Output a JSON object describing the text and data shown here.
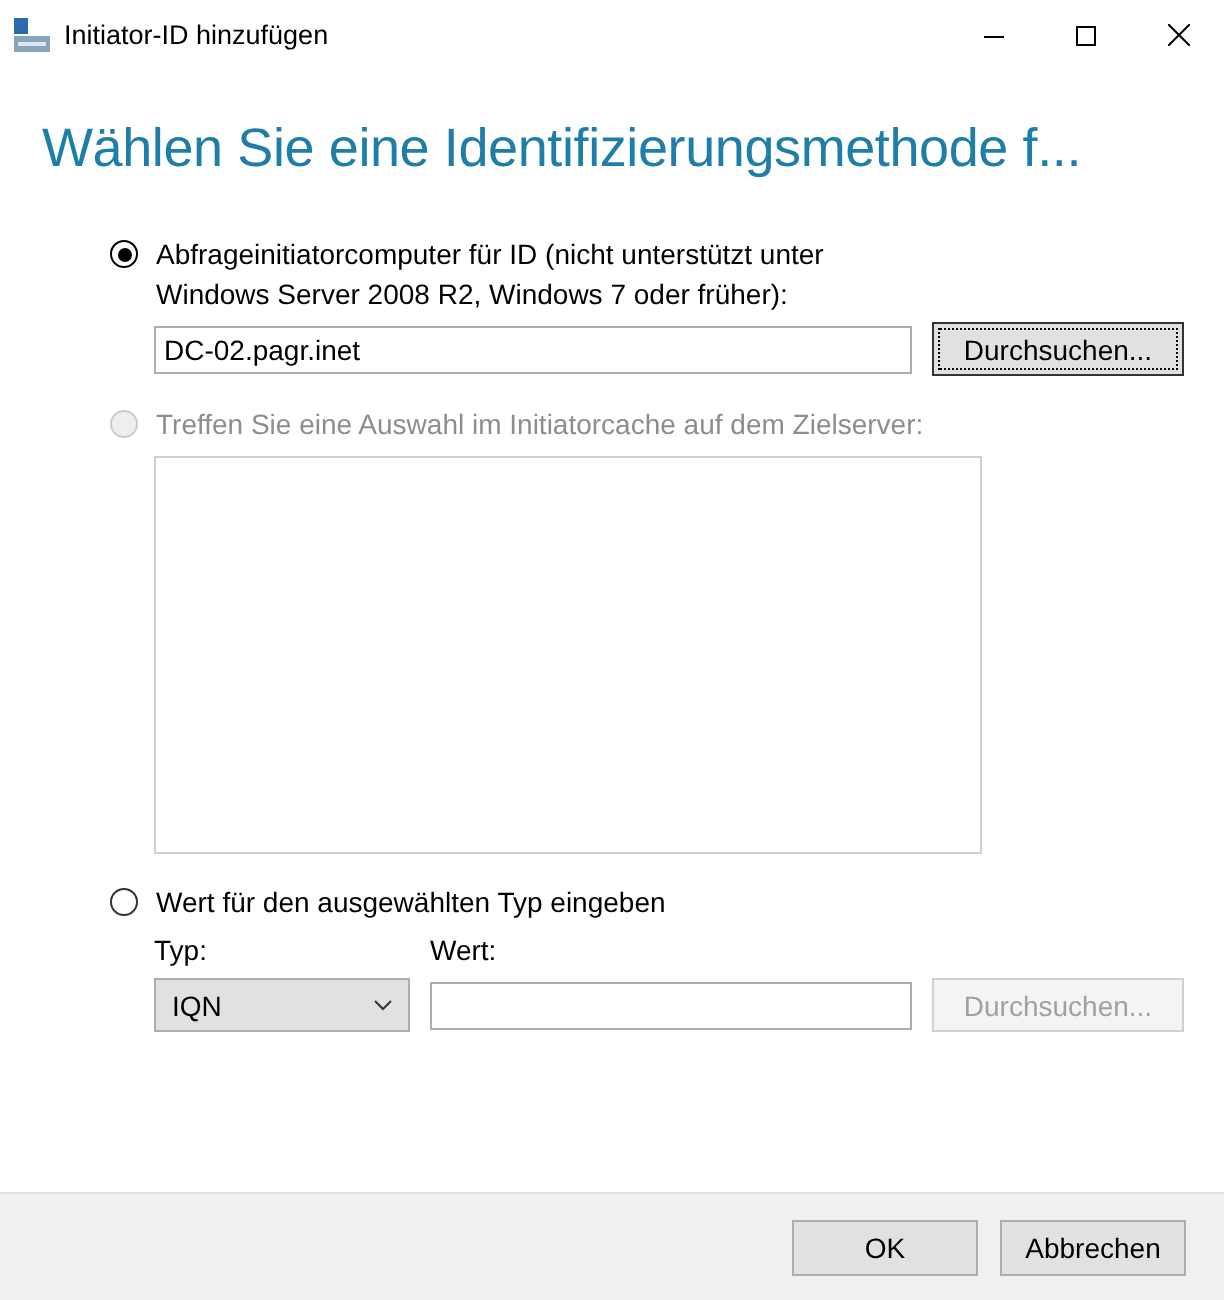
{
  "window": {
    "title": "Initiator-ID hinzufügen"
  },
  "heading": "Wählen Sie eine Identifizierungsmethode f...",
  "options": [
    {
      "label": "Abfrageinitiatorcomputer für ID (nicht unterstützt unter Windows Server 2008 R2, Windows 7 oder früher):",
      "selected": true,
      "disabled": false
    },
    {
      "label": "Treffen Sie eine Auswahl im Initiatorcache auf dem Zielserver:",
      "selected": false,
      "disabled": true
    },
    {
      "label": "Wert für den ausgewählten Typ eingeben",
      "selected": false,
      "disabled": false
    }
  ],
  "query": {
    "value": "DC-02.pagr.inet",
    "browse": {
      "label": "Durchsuchen...",
      "disabled": false,
      "focused": true
    }
  },
  "manual": {
    "type_label": "Typ:",
    "type_value": "IQN",
    "value_label": "Wert:",
    "browse": {
      "label": "Durchsuchen...",
      "disabled": true,
      "focused": false
    }
  },
  "buttons": [
    "OK",
    "Abbrechen"
  ]
}
